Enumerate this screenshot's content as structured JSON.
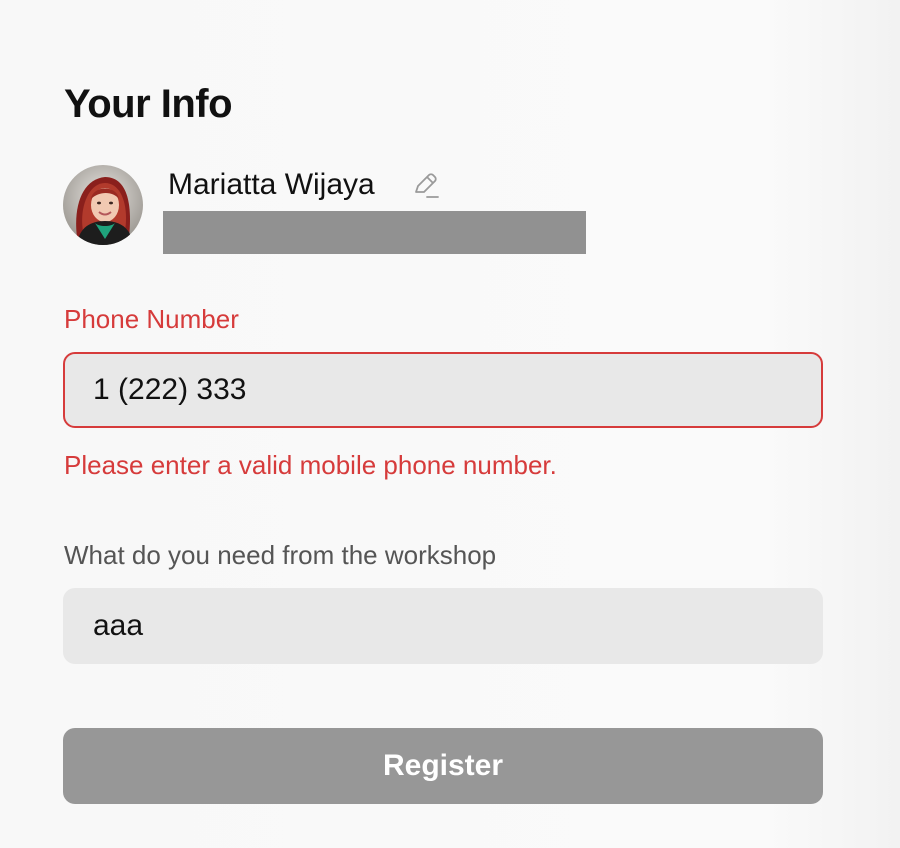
{
  "section": {
    "title": "Your Info"
  },
  "profile": {
    "name": "Mariatta Wijaya",
    "edit_icon": "pencil-icon"
  },
  "phone": {
    "label": "Phone Number",
    "value": "1 (222) 333",
    "error": "Please enter a valid mobile phone number."
  },
  "need": {
    "label": "What do you need from the workshop",
    "value": "aaa"
  },
  "actions": {
    "register_label": "Register"
  },
  "colors": {
    "error": "#d63b3b",
    "input_bg": "#e8e8e8",
    "button_disabled": "#979797",
    "redacted": "#919191"
  }
}
